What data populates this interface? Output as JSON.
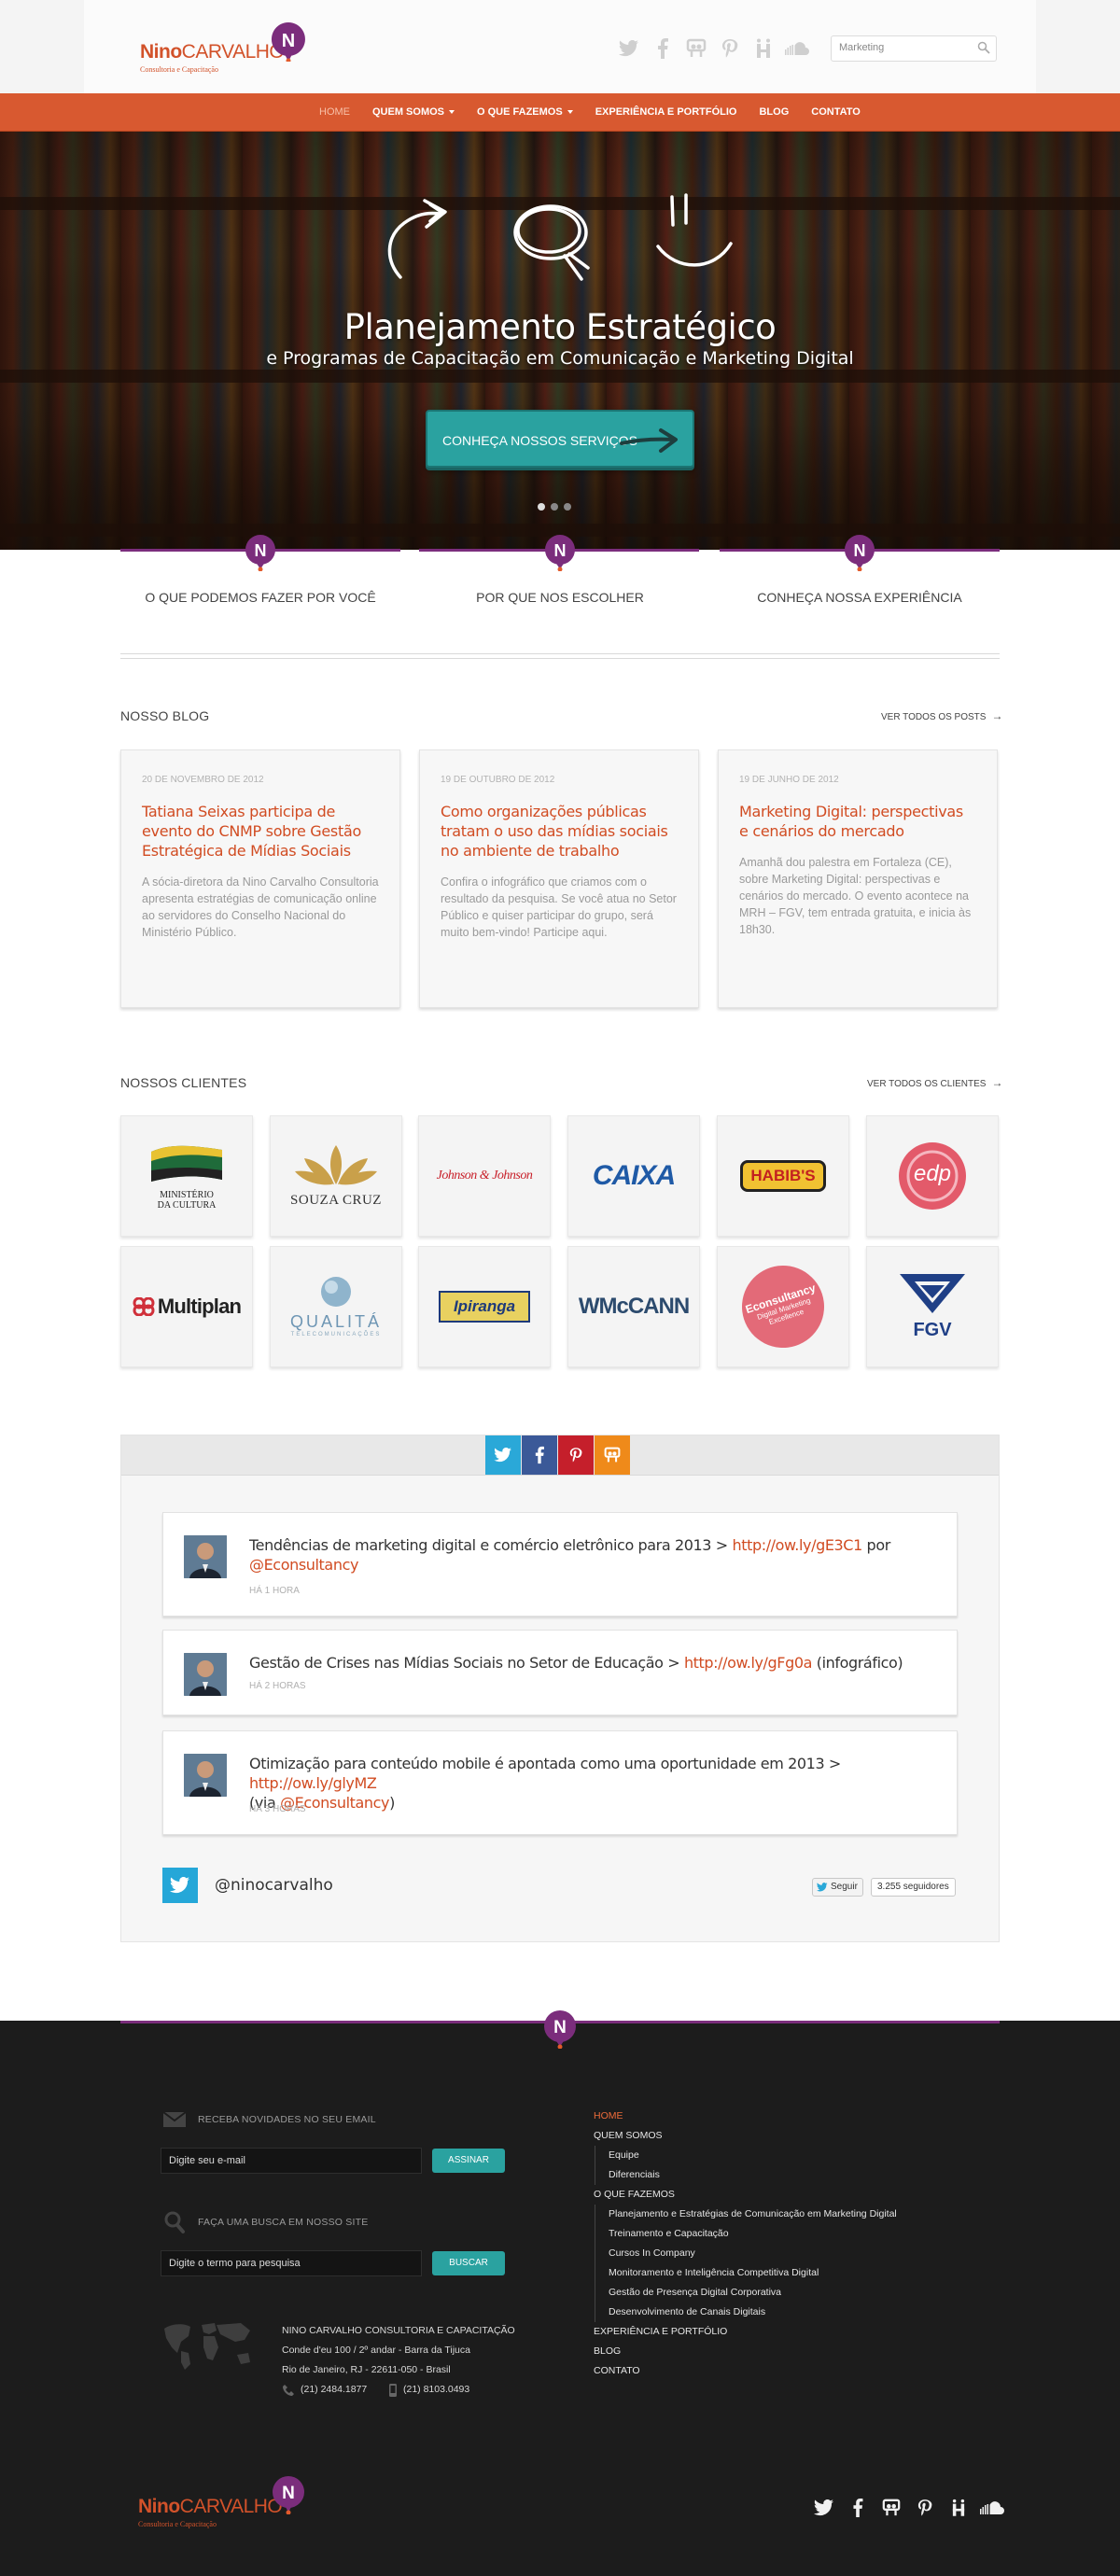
{
  "brand": {
    "name_bold": "Nino",
    "name_rest": "CARVALHO",
    "tagline": "Consultoria e Capacitação",
    "badge_letter": "N",
    "primary_color": "#d85930",
    "accent_color": "#7b2d7c",
    "teal_color": "#2aa2a0"
  },
  "header": {
    "social_icons": [
      "twitter-icon",
      "facebook-icon",
      "slideshare-icon",
      "pinterest-icon",
      "hi5-icon",
      "soundcloud-icon"
    ],
    "search_value": "Marketing"
  },
  "nav": {
    "items": [
      {
        "label": "HOME",
        "active": true
      },
      {
        "label": "QUEM SOMOS",
        "dropdown": true
      },
      {
        "label": "O QUE FAZEMOS",
        "dropdown": true
      },
      {
        "label": "EXPERIÊNCIA E PORTFÓLIO"
      },
      {
        "label": "BLOG"
      },
      {
        "label": "CONTATO"
      }
    ]
  },
  "hero": {
    "title": "Planejamento Estratégico",
    "subtitle": "e Programas de Capacitação em Comunicação e Marketing Digital",
    "cta": "CONHEÇA NOSSOS SERVIÇOS",
    "slides": 3,
    "active_slide": 1
  },
  "features": [
    {
      "label": "O QUE PODEMOS FAZER POR VOCÊ"
    },
    {
      "label": "POR QUE NOS ESCOLHER"
    },
    {
      "label": "CONHEÇA NOSSA EXPERIÊNCIA"
    }
  ],
  "blog": {
    "title": "NOSSO BLOG",
    "link": "VER TODOS OS POSTS",
    "posts": [
      {
        "date": "20 DE NOVEMBRO DE 2012",
        "title": "Tatiana Seixas participa de evento do CNMP sobre Gestão Estratégica de Mídias Sociais",
        "excerpt": "A sócia-diretora da Nino Carvalho Consultoria apresenta estratégias de comunicação online ao servidores do Conselho Nacional do Ministério Público."
      },
      {
        "date": "19 DE OUTUBRO DE 2012",
        "title": "Como organizações públicas tratam o uso das mídias sociais no ambiente de trabalho",
        "excerpt": "Confira o infográfico que criamos com o resultado da pesquisa. Se você atua no Setor Público e quiser participar do grupo, será muito bem-vindo! Participe aqui."
      },
      {
        "date": "19 DE JUNHO DE 2012",
        "title": "Marketing Digital: perspectivas e cenários do mercado",
        "excerpt": "Amanhã dou palestra em Fortaleza (CE), sobre Marketing Digital: perspectivas e cenários do mercado. O evento acontece na MRH – FGV, tem entrada gratuita, e inicia às 18h30."
      }
    ]
  },
  "clients": {
    "title": "NOSSOS CLIENTES",
    "link": "VER TODOS OS CLIENTES",
    "logos": {
      "minc_line1": "MINISTÉRIO",
      "minc_line2": "DA CULTURA",
      "souza": "SOUZA CRUZ",
      "jj": "Johnson & Johnson",
      "caixa": "CAIXA",
      "habibs": "HABIB'S",
      "edp": "edp",
      "multiplan": "Multiplan",
      "qualita": "QUALITÁ",
      "qualita_sub": "TELECOMUNICAÇÕES",
      "ipiranga": "Ipiranga",
      "wmccann": "WMcCANN",
      "econsultancy": "Econsultancy",
      "econsultancy_sub": "Digital Marketing Excellence",
      "fgv": "FGV"
    }
  },
  "social_feed": {
    "tabs": [
      "twitter-icon",
      "facebook-icon",
      "pinterest-icon",
      "slideshare-icon"
    ],
    "tweets": [
      {
        "pre": "Tendências de marketing digital e comércio eletrônico para 2013 > ",
        "link": "http://ow.ly/gE3C1",
        "mid": " por ",
        "mention": "@Econsultancy",
        "post": "",
        "time": "HÁ 1 HORA"
      },
      {
        "pre": "Gestão de Crises nas Mídias Sociais no Setor de Educação > ",
        "link": "http://ow.ly/gFg0a",
        "mid": "  (infográfico)",
        "mention": "",
        "post": "",
        "time": "HÁ 2 HORAS"
      },
      {
        "pre": "Otimização para conteúdo mobile é apontada como uma oportunidade em 2013 > ",
        "link": "http://ow.ly/glyMZ",
        "mid": " (via ",
        "mention": "@Econsultancy",
        "post": ")",
        "time": "HÁ 3 HORAS"
      }
    ],
    "handle": "@ninocarvalho",
    "follow": "Seguir",
    "followers": "3.255 seguidores"
  },
  "footer": {
    "newsletter_label": "RECEBA NOVIDADES NO SEU EMAIL",
    "email_placeholder": "Digite seu e-mail",
    "subscribe": "ASSINAR",
    "search_label": "FAÇA UMA BUSCA EM NOSSO SITE",
    "search_placeholder": "Digite o termo para pesquisa",
    "search_btn": "BUSCAR",
    "company": "NINO CARVALHO CONSULTORIA E CAPACITAÇÃO",
    "address1": "Conde d'eu 100 / 2º andar - Barra da Tijuca",
    "address2": "Rio de Janeiro, RJ - 22611-050 - Brasil",
    "phone": "(21) 2484.1877",
    "mobile": "(21) 8103.0493",
    "menu": [
      {
        "label": "HOME",
        "active": true
      },
      {
        "label": "QUEM SOMOS"
      },
      {
        "label": "Equipe",
        "sub": true
      },
      {
        "label": "Diferenciais",
        "sub": true
      },
      {
        "label": "O QUE FAZEMOS"
      },
      {
        "label": "Planejamento e Estratégias de Comunicação em Marketing Digital",
        "sub": true
      },
      {
        "label": "Treinamento e Capacitação",
        "sub": true
      },
      {
        "label": "Cursos In Company",
        "sub": true
      },
      {
        "label": "Monitoramento e Inteligência Competitiva Digital",
        "sub": true
      },
      {
        "label": "Gestão de Presença Digital Corporativa",
        "sub": true
      },
      {
        "label": "Desenvolvimento de Canais Digitais",
        "sub": true
      },
      {
        "label": "EXPERIÊNCIA E PORTFÓLIO"
      },
      {
        "label": "BLOG"
      },
      {
        "label": "CONTATO"
      }
    ],
    "social_icons": [
      "twitter-icon",
      "facebook-icon",
      "slideshare-icon",
      "pinterest-icon",
      "hi5-icon",
      "soundcloud-icon"
    ]
  }
}
